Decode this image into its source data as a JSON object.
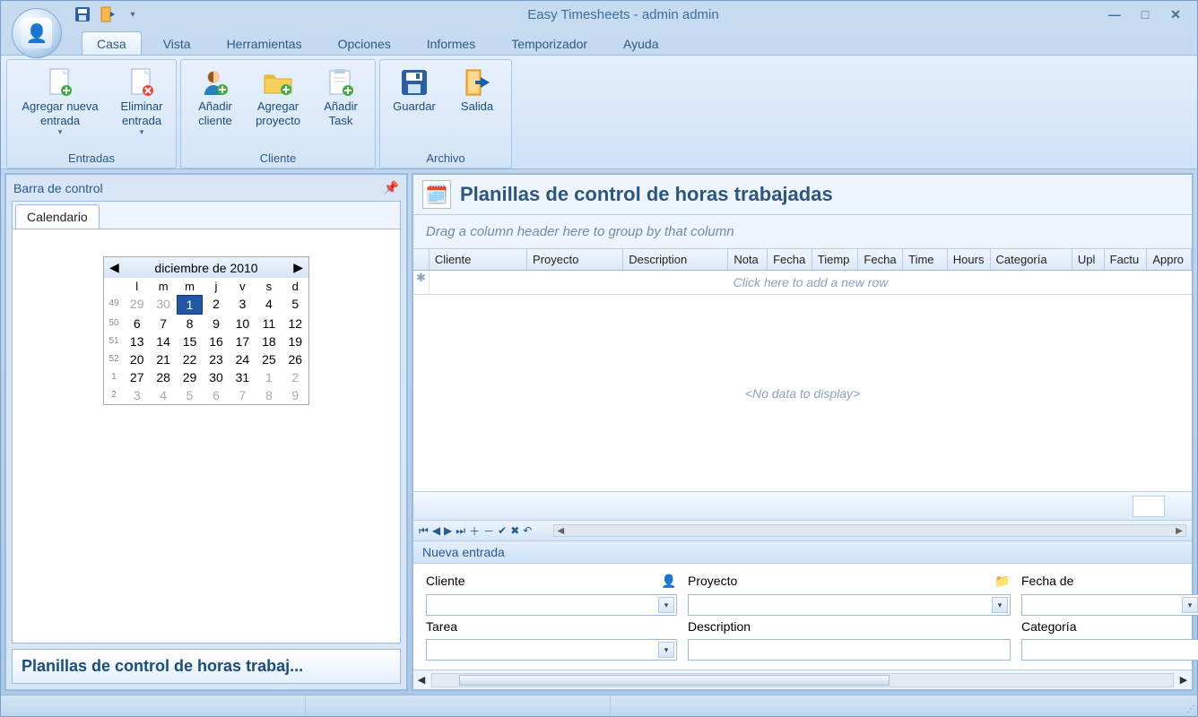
{
  "app": {
    "title": "Easy Timesheets - admin admin"
  },
  "ribbon": {
    "tabs": [
      "Casa",
      "Vista",
      "Herramientas",
      "Opciones",
      "Informes",
      "Temporizador",
      "Ayuda"
    ],
    "active_tab": "Casa",
    "groups": {
      "entradas": {
        "title": "Entradas",
        "add_entry": "Agregar nueva\nentrada",
        "delete_entry": "Eliminar\nentrada"
      },
      "cliente": {
        "title": "Cliente",
        "add_client": "Añadir\ncliente",
        "add_project": "Agregar\nproyecto",
        "add_task": "Añadir\nTask"
      },
      "archivo": {
        "title": "Archivo",
        "save": "Guardar",
        "exit": "Salida"
      }
    }
  },
  "left": {
    "header": "Barra de control",
    "tab": "Calendario",
    "footer": "Planillas de control de horas trabaj...",
    "calendar": {
      "title": "diciembre de 2010",
      "dow": [
        "l",
        "m",
        "m",
        "j",
        "v",
        "s",
        "d"
      ],
      "weeks": [
        {
          "wn": "49",
          "days": [
            {
              "d": "29",
              "muted": true
            },
            {
              "d": "30",
              "muted": true
            },
            {
              "d": "1",
              "sel": true
            },
            {
              "d": "2"
            },
            {
              "d": "3"
            },
            {
              "d": "4"
            },
            {
              "d": "5"
            }
          ]
        },
        {
          "wn": "50",
          "days": [
            {
              "d": "6"
            },
            {
              "d": "7"
            },
            {
              "d": "8"
            },
            {
              "d": "9"
            },
            {
              "d": "10"
            },
            {
              "d": "11"
            },
            {
              "d": "12"
            }
          ]
        },
        {
          "wn": "51",
          "days": [
            {
              "d": "13"
            },
            {
              "d": "14"
            },
            {
              "d": "15"
            },
            {
              "d": "16"
            },
            {
              "d": "17"
            },
            {
              "d": "18"
            },
            {
              "d": "19"
            }
          ]
        },
        {
          "wn": "52",
          "days": [
            {
              "d": "20"
            },
            {
              "d": "21"
            },
            {
              "d": "22"
            },
            {
              "d": "23"
            },
            {
              "d": "24"
            },
            {
              "d": "25"
            },
            {
              "d": "26"
            }
          ]
        },
        {
          "wn": "1",
          "days": [
            {
              "d": "27"
            },
            {
              "d": "28"
            },
            {
              "d": "29"
            },
            {
              "d": "30"
            },
            {
              "d": "31"
            },
            {
              "d": "1",
              "muted": true
            },
            {
              "d": "2",
              "muted": true
            }
          ]
        },
        {
          "wn": "2",
          "days": [
            {
              "d": "3",
              "muted": true
            },
            {
              "d": "4",
              "muted": true
            },
            {
              "d": "5",
              "muted": true
            },
            {
              "d": "6",
              "muted": true
            },
            {
              "d": "7",
              "muted": true
            },
            {
              "d": "8",
              "muted": true
            },
            {
              "d": "9",
              "muted": true
            }
          ]
        }
      ]
    }
  },
  "grid": {
    "title": "Planillas de control de horas trabajadas",
    "group_hint": "Drag a column header here to group by that column",
    "columns": [
      "Cliente",
      "Proyecto",
      "Description",
      "Nota",
      "Fecha",
      "Tiemp",
      "Fecha",
      "Time",
      "Hours",
      "Categoría",
      "Upl",
      "Factu",
      "Appro"
    ],
    "new_row_hint": "Click here to add a new row",
    "empty": "<No data to display>"
  },
  "form": {
    "title": "Nueva entrada",
    "cliente": "Cliente",
    "proyecto": "Proyecto",
    "fecha": "Fecha de",
    "tarea": "Tarea",
    "description": "Description",
    "categoria": "Categoría"
  }
}
